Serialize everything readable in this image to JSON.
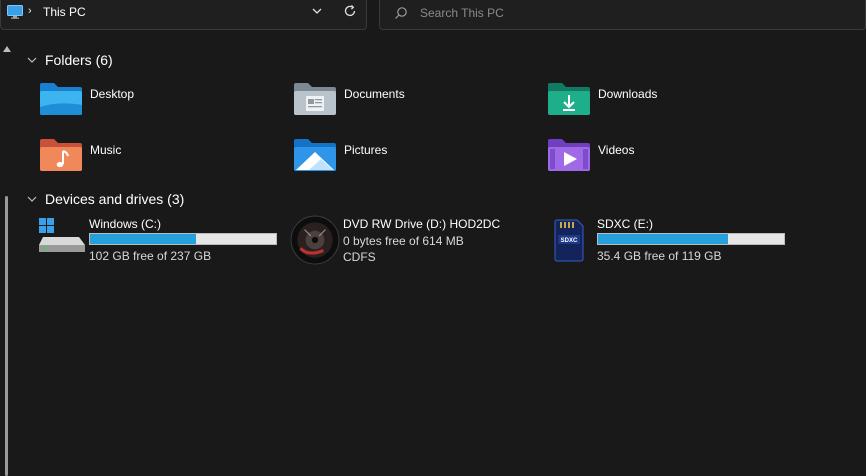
{
  "address": {
    "location_icon": "this-pc-icon",
    "separator": "›",
    "crumb": "This PC"
  },
  "search": {
    "placeholder": "Search This PC"
  },
  "sections": {
    "folders": {
      "title": "Folders (6)"
    },
    "drives": {
      "title": "Devices and drives (3)"
    }
  },
  "folders": [
    {
      "label": "Desktop",
      "icon": "desktop-folder-icon"
    },
    {
      "label": "Documents",
      "icon": "documents-folder-icon"
    },
    {
      "label": "Downloads",
      "icon": "downloads-folder-icon"
    },
    {
      "label": "Music",
      "icon": "music-folder-icon"
    },
    {
      "label": "Pictures",
      "icon": "pictures-folder-icon"
    },
    {
      "label": "Videos",
      "icon": "videos-folder-icon"
    }
  ],
  "drives": [
    {
      "name": "Windows (C:)",
      "free": "102 GB free of 237 GB",
      "used_fraction": 0.57,
      "icon": "windows-drive-icon"
    },
    {
      "name": "DVD RW Drive (D:) HOD2DC",
      "free": "0 bytes free of 614 MB",
      "fs": "CDFS",
      "icon": "dvd-disc-icon"
    },
    {
      "name": "SDXC (E:)",
      "free": "35.4 GB free of 119 GB",
      "used_fraction": 0.7,
      "icon": "sd-card-icon"
    }
  ],
  "colors": {
    "background": "#191919",
    "accent_bar": "#26a0da",
    "bar_track": "#e6e6e6"
  }
}
